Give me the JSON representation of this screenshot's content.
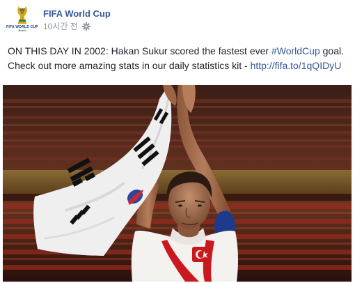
{
  "post": {
    "page_name": "FIFA World Cup",
    "timestamp": "10시간 전",
    "avatar_text": "FIFA WORLD CUP",
    "avatar_subtext": "Brasil",
    "text": {
      "line1_prefix": "ON THIS DAY IN 2002: Hakan Sukur scored the fastest ever ",
      "hashtag": "#WorldCup",
      "line1_suffix": " goal.",
      "line2_prefix": "Check out more amazing stats in our daily statistics kit - ",
      "link": "http://fifa.to/1qQIDyU"
    },
    "photo": {
      "subject": "player applauding with flag in stadium"
    }
  },
  "colors": {
    "link": "#365899",
    "timestamp": "#90949c",
    "text": "#1d2129"
  },
  "icons": [
    "fifa-world-cup-logo",
    "gear-icon"
  ]
}
